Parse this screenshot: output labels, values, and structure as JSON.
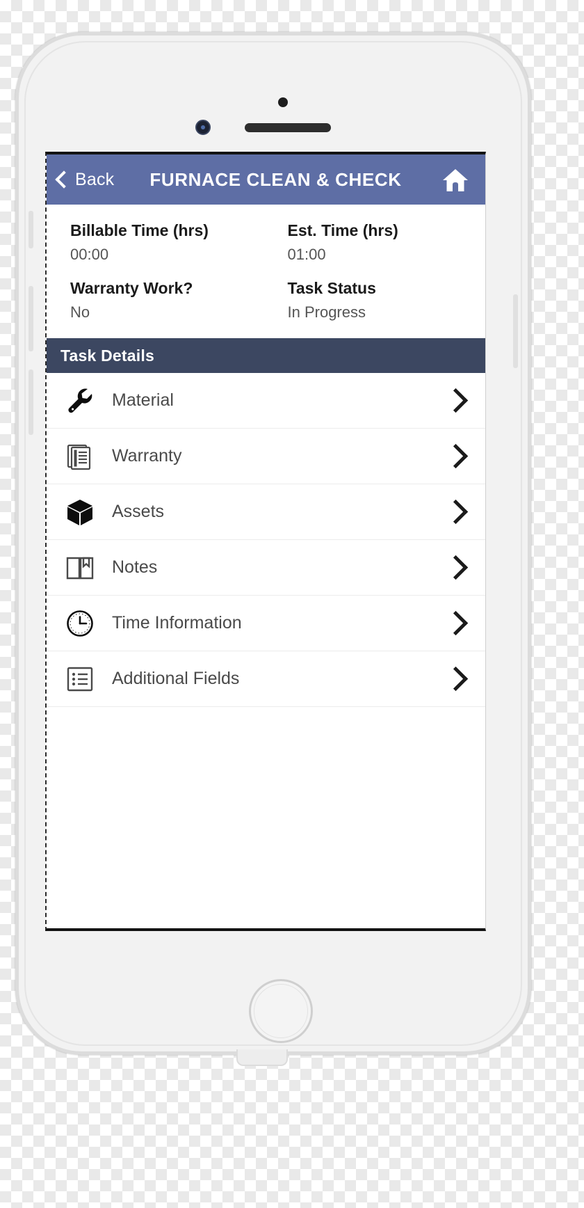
{
  "navbar": {
    "back_label": "Back",
    "title": "FURNACE CLEAN & CHECK",
    "home_icon": "home-icon",
    "back_icon": "chevron-left-icon",
    "background_color": "#5e6ea5"
  },
  "info": {
    "rows": [
      {
        "left_label": "Billable Time (hrs)",
        "left_value": "00:00",
        "right_label": "Est. Time (hrs)",
        "right_value": "01:00"
      },
      {
        "left_label": "Warranty Work?",
        "left_value": "No",
        "right_label": "Task Status",
        "right_value": "In Progress"
      }
    ]
  },
  "section": {
    "title": "Task Details",
    "background_color": "#3c4761"
  },
  "list": {
    "items": [
      {
        "label": "Material",
        "icon": "wrench-icon",
        "chevron": "chevron-right-icon"
      },
      {
        "label": "Warranty",
        "icon": "document-icon",
        "chevron": "chevron-right-icon"
      },
      {
        "label": "Assets",
        "icon": "cube-icon",
        "chevron": "chevron-right-icon"
      },
      {
        "label": "Notes",
        "icon": "open-book-icon",
        "chevron": "chevron-right-icon"
      },
      {
        "label": "Time Information",
        "icon": "clock-icon",
        "chevron": "chevron-right-icon"
      },
      {
        "label": "Additional Fields",
        "icon": "list-icon",
        "chevron": "chevron-right-icon"
      }
    ]
  },
  "device": {
    "speaker": "earpiece-speaker",
    "camera": "front-camera",
    "home_button": "home-button"
  }
}
